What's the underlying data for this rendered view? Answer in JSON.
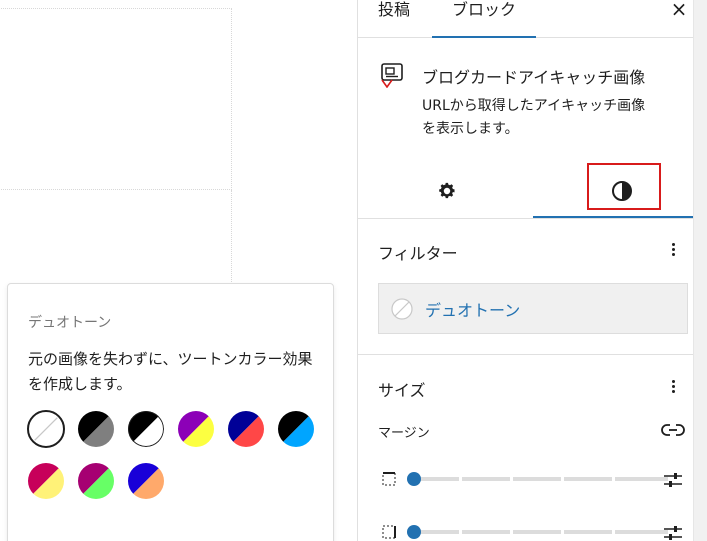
{
  "popover": {
    "title": "デュオトーン",
    "description": "元の画像を失わずに、ツートンカラー効果を作成します。",
    "swatches": [
      {
        "name": "none",
        "colors": [
          "#ffffff",
          "#ffffff"
        ]
      },
      {
        "name": "dark-grayscale",
        "colors": [
          "#000000",
          "#7f7f7f"
        ]
      },
      {
        "name": "grayscale",
        "colors": [
          "#000000",
          "#ffffff"
        ]
      },
      {
        "name": "purple-yellow",
        "colors": [
          "#8c00b7",
          "#fcff41"
        ]
      },
      {
        "name": "blue-red",
        "colors": [
          "#000097",
          "#ff4747"
        ]
      },
      {
        "name": "midnight",
        "colors": [
          "#000000",
          "#00a5ff"
        ]
      },
      {
        "name": "magenta-yellow",
        "colors": [
          "#c7005a",
          "#fff278"
        ]
      },
      {
        "name": "purple-green",
        "colors": [
          "#a60072",
          "#67ff66"
        ]
      },
      {
        "name": "blue-orange",
        "colors": [
          "#1900d8",
          "#ffa96b"
        ]
      }
    ]
  },
  "sidebar": {
    "tabs": {
      "post": "投稿",
      "block": "ブロック"
    },
    "close": "×",
    "block": {
      "name": "ブログカードアイキャッチ画像",
      "description": "URLから取得したアイキャッチ画像を表示します。"
    },
    "subtabs": {
      "settings_icon": "gear-icon",
      "styles_icon": "contrast-icon"
    },
    "filter": {
      "title": "フィルター",
      "duotone_label": "デュオトーン"
    },
    "size": {
      "title": "サイズ",
      "margin_label": "マージン"
    },
    "accent": "#2271b1",
    "highlight": "#d81b1b"
  }
}
